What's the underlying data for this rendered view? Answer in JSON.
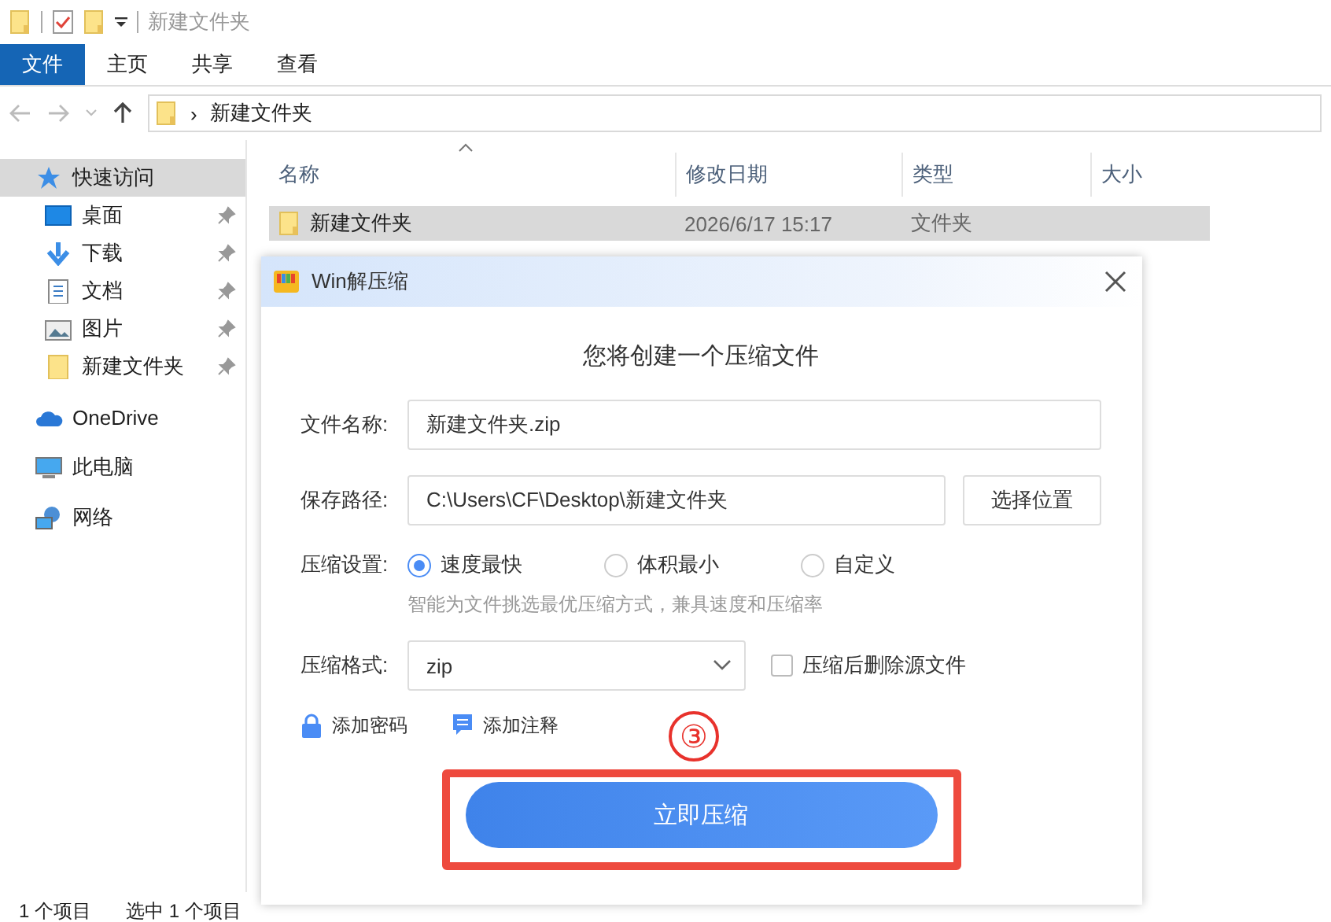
{
  "title_bar": {
    "title": "新建文件夹"
  },
  "ribbon_tabs": [
    {
      "label": "文件",
      "selected": true
    },
    {
      "label": "主页",
      "selected": false
    },
    {
      "label": "共享",
      "selected": false
    },
    {
      "label": "查看",
      "selected": false
    }
  ],
  "address_bar": {
    "separator": "›",
    "path": "新建文件夹"
  },
  "sidebar": {
    "items": [
      {
        "label": "快速访问",
        "kind": "star",
        "selected": true,
        "children": [
          {
            "label": "桌面",
            "kind": "desktop",
            "pinned": true,
            "selected": false
          },
          {
            "label": "下载",
            "kind": "download",
            "pinned": true,
            "selected": false
          },
          {
            "label": "文档",
            "kind": "document",
            "pinned": true,
            "selected": false
          },
          {
            "label": "图片",
            "kind": "pictures",
            "pinned": true,
            "selected": false
          },
          {
            "label": "新建文件夹",
            "kind": "folder",
            "pinned": true,
            "selected": false
          }
        ]
      },
      {
        "label": "OneDrive",
        "kind": "cloud",
        "selected": false
      },
      {
        "label": "此电脑",
        "kind": "computer",
        "selected": false
      },
      {
        "label": "网络",
        "kind": "network",
        "selected": false
      }
    ]
  },
  "file_list": {
    "columns": [
      "名称",
      "修改日期",
      "类型",
      "大小"
    ],
    "rows": [
      {
        "name": "新建文件夹",
        "modified": "2026/6/17 15:17",
        "type": "文件夹",
        "selected": true
      }
    ]
  },
  "dialog": {
    "title": "Win解压缩",
    "heading": "您将创建一个压缩文件",
    "file_name": {
      "label": "文件名称:",
      "value": "新建文件夹.zip"
    },
    "save_path": {
      "label": "保存路径:",
      "value": "C:\\Users\\CF\\Desktop\\新建文件夹",
      "button": "选择位置"
    },
    "compression": {
      "label": "压缩设置:",
      "options": [
        {
          "label": "速度最快",
          "selected": true
        },
        {
          "label": "体积最小",
          "selected": false
        },
        {
          "label": "自定义",
          "selected": false
        }
      ],
      "hint": "智能为文件挑选最优压缩方式，兼具速度和压缩率"
    },
    "format": {
      "label": "压缩格式:",
      "value": "zip"
    },
    "delete_source": {
      "label": "压缩后删除源文件",
      "checked": false
    },
    "links": [
      {
        "label": "添加密码",
        "kind": "password"
      },
      {
        "label": "添加注释",
        "kind": "comment"
      }
    ],
    "primary_button": "立即压缩"
  },
  "annotation": {
    "step": "③"
  },
  "status_bar": [
    "1 个项目",
    "选中 1 个项目"
  ]
}
